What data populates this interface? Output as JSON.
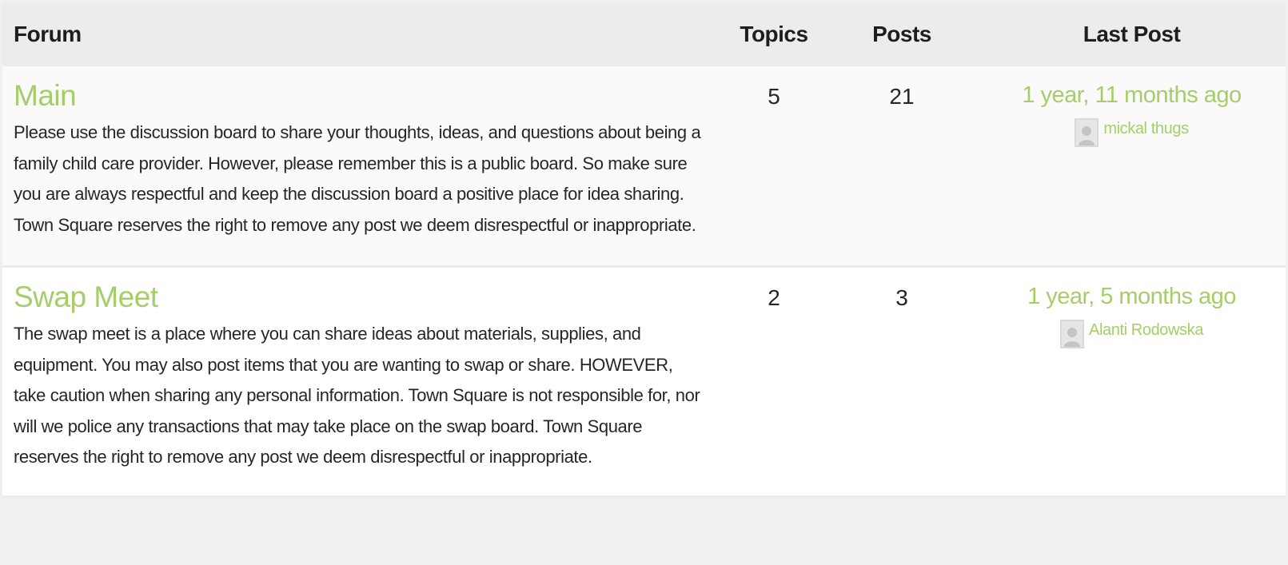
{
  "table": {
    "headers": {
      "forum": "Forum",
      "topics": "Topics",
      "posts": "Posts",
      "last_post": "Last Post"
    },
    "forums": [
      {
        "title": "Main",
        "description": "Please use the discussion board to share your thoughts, ideas, and questions about being a family child care provider. However, please remember this is a public board. So make sure you are always respectful and keep the discussion board a positive place for idea sharing. Town Square reserves the right to remove any post we deem disrespectful or inappropriate.",
        "topics": "5",
        "posts": "21",
        "last_post_time": "1 year, 11 months ago",
        "last_post_author": "mickal thugs",
        "avatar_icon": "user-avatar-icon"
      },
      {
        "title": "Swap Meet",
        "description": "The swap meet is a place where you can share ideas about materials, supplies, and equipment. You may also post items that you are wanting to swap or share. HOWEVER, take caution when sharing any personal information. Town Square is not responsible for, nor will we police any transactions that may take place on the swap board. Town Square reserves the right to remove any post we deem disrespectful or inappropriate.",
        "topics": "2",
        "posts": "3",
        "last_post_time": "1 year, 5 months ago",
        "last_post_author": "Alanti Rodowska",
        "avatar_icon": "user-avatar-icon"
      }
    ]
  },
  "colors": {
    "accent": "#a6cd6a",
    "text": "#262626",
    "header_bg": "#ececec",
    "page_bg": "#f0f0f0"
  }
}
